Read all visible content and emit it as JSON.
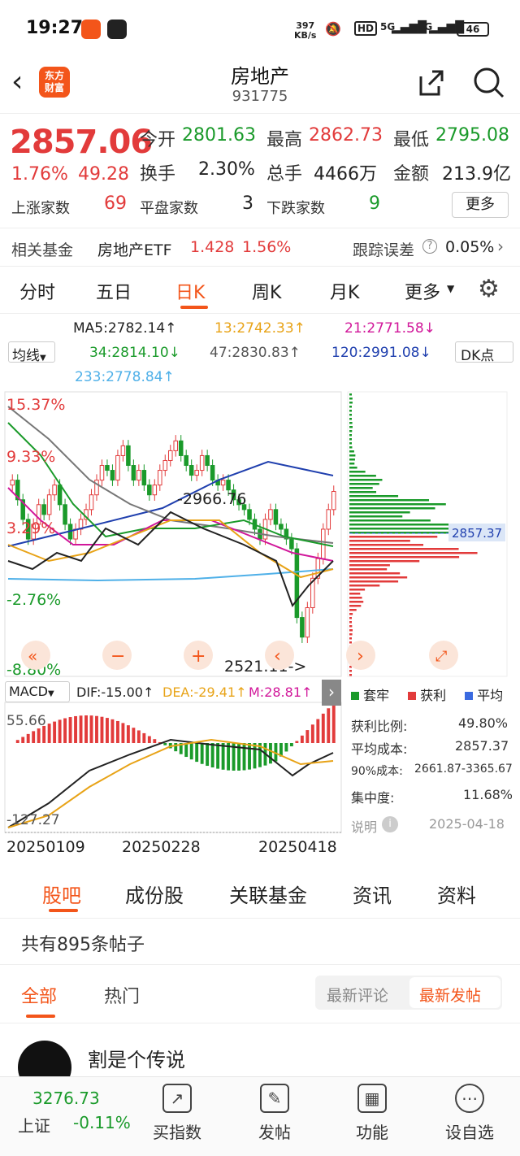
{
  "status_bar": {
    "time": "19:27",
    "net_speed_value": "397",
    "net_speed_unit": "KB/s",
    "hd": "HD",
    "sig1": "5G",
    "sig2": "5G",
    "battery": "46"
  },
  "header": {
    "logo_line1": "东方",
    "logo_line2": "财富",
    "title": "房地产",
    "code": "931775"
  },
  "quote": {
    "price": "2857.06",
    "change_pct": "1.76%",
    "change": "49.28",
    "open_label": "今开",
    "open": "2801.63",
    "high_label": "最高",
    "high": "2862.73",
    "low_label": "最低",
    "low": "2795.08",
    "turnover_label": "换手",
    "turnover": "2.30%",
    "volume_label": "总手",
    "volume": "4466万",
    "amount_label": "金额",
    "amount": "213.9亿",
    "up_label": "上涨家数",
    "up": "69",
    "flat_label": "平盘家数",
    "flat": "3",
    "down_label": "下跌家数",
    "down": "9",
    "more": "更多"
  },
  "fund": {
    "label": "相关基金",
    "name": "房地产ETF",
    "price": "1.428",
    "pct": "1.56%",
    "track_label": "跟踪误差",
    "track_value": "0.05%"
  },
  "tabs": [
    "分时",
    "五日",
    "日K",
    "周K",
    "月K",
    "更多"
  ],
  "active_tab": "日K",
  "ma": {
    "selector": "均线",
    "ma5": "MA5:2782.14",
    "ma13": "13:2742.33",
    "ma21": "21:2771.58",
    "ma34": "34:2814.10",
    "ma47": "47:2830.83",
    "ma120": "120:2991.08",
    "ma233": "233:2778.84",
    "dk": "DK点"
  },
  "chart_data": {
    "type": "candlestick",
    "y_pct_labels": [
      "15.37%",
      "9.33%",
      "3.29%",
      "-2.76%",
      "-8.80%"
    ],
    "annotations": [
      "2966.76",
      "2521.11"
    ],
    "current_price_label": "2857.37",
    "x_labels": [
      "20250109",
      "20250228",
      "20250418"
    ],
    "closes": [
      2880,
      2840,
      2800,
      2760,
      2790,
      2830,
      2810,
      2850,
      2870,
      2830,
      2790,
      2760,
      2780,
      2800,
      2820,
      2850,
      2880,
      2910,
      2900,
      2880,
      2930,
      2950,
      2910,
      2880,
      2900,
      2870,
      2850,
      2870,
      2900,
      2920,
      2940,
      2960,
      2930,
      2910,
      2890,
      2900,
      2930,
      2910,
      2880,
      2870,
      2880,
      2860,
      2840,
      2830,
      2820,
      2800,
      2780,
      2760,
      2800,
      2820,
      2790,
      2780,
      2760,
      2740,
      2600,
      2560,
      2620,
      2680,
      2720,
      2780,
      2820,
      2857
    ],
    "macd": {
      "label": "MACD",
      "dif": "DIF:-15.00",
      "dea": "DEA:-29.41",
      "m": "M:28.81",
      "ymax": "55.66",
      "ymin": "-127.27"
    }
  },
  "chips": {
    "legend_trap": "套牢",
    "legend_profit": "获利",
    "legend_avg": "平均",
    "profit_ratio_label": "获利比例:",
    "profit_ratio": "49.80%",
    "avg_cost_label": "平均成本:",
    "avg_cost": "2857.37",
    "cost90_label": "90%成本:",
    "cost90": "2661.87-3365.67",
    "concentration_label": "集中度:",
    "concentration": "11.68%",
    "note": "说明",
    "date": "2025-04-18"
  },
  "bottom_tabs": [
    "股吧",
    "成份股",
    "关联基金",
    "资讯",
    "资料"
  ],
  "posts": {
    "count_text": "共有895条帖子",
    "filter_all": "全部",
    "filter_hot": "热门",
    "sort_comment": "最新评论",
    "sort_post": "最新发帖",
    "first_user": "割是个传说"
  },
  "nav": {
    "index_value": "3276.73",
    "index_name": "上证",
    "index_pct": "-0.11%",
    "buy": "买指数",
    "post": "发帖",
    "func": "功能",
    "watch": "设自选"
  },
  "colors": {
    "up": "#e23b3b",
    "down": "#1a9a2a",
    "accent": "#f3551a"
  }
}
